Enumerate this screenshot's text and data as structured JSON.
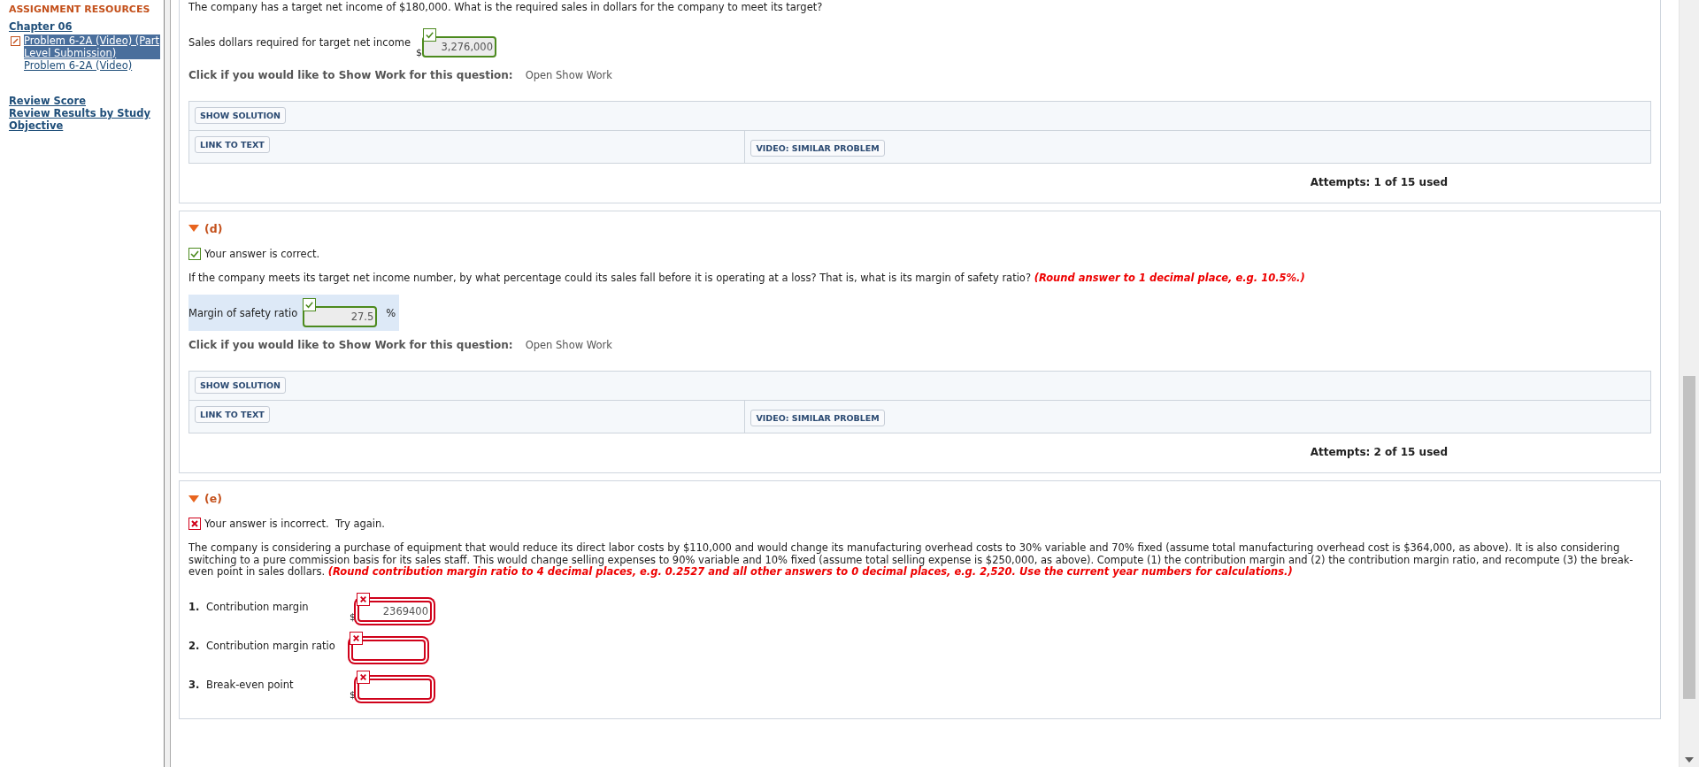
{
  "sidebar": {
    "heading": "ASSIGNMENT RESOURCES",
    "chapter": "Chapter 06",
    "items": [
      {
        "label": "Problem 6-2A (Video) (Part Level Submission)",
        "selected": true
      },
      {
        "label": "Problem 6-2A (Video)",
        "selected": false
      }
    ],
    "links": [
      "Review Score",
      "Review Results by Study Objective"
    ]
  },
  "parts": [
    {
      "question": {
        "text": "The company has a target net income of $180,000. What is the required sales in dollars for the company to meet its target?"
      },
      "answers": [
        {
          "label": "Sales dollars required for target net income",
          "prefix": "$",
          "value": "3,276,000",
          "correct": true,
          "highlighted": false
        }
      ],
      "show_work": {
        "prompt": "Click if you would like to Show Work for this question:",
        "link": "Open Show Work"
      },
      "resources": [
        [
          "SHOW SOLUTION"
        ],
        [
          "LINK TO TEXT",
          "VIDEO: SIMILAR PROBLEM"
        ]
      ],
      "attempts": "Attempts: 1 of 15 used"
    },
    {
      "label": "(d)",
      "expanded": true,
      "feedback": {
        "correct": true,
        "text": "Your answer is correct."
      },
      "question": {
        "text": "If the company meets its target net income number, by what percentage could its sales fall before it is operating at a loss? That is, what is its margin of safety ratio?",
        "instruction": "(Round answer to 1 decimal place, e.g. 10.5%.)"
      },
      "answers": [
        {
          "label": "Margin of safety ratio",
          "value": "27.5",
          "unit": "%",
          "correct": true,
          "highlighted": true
        }
      ],
      "show_work": {
        "prompt": "Click if you would like to Show Work for this question:",
        "link": "Open Show Work"
      },
      "resources": [
        [
          "SHOW SOLUTION"
        ],
        [
          "LINK TO TEXT",
          "VIDEO: SIMILAR PROBLEM"
        ]
      ],
      "attempts": "Attempts: 2 of 15 used"
    },
    {
      "label": "(e)",
      "expanded": true,
      "feedback": {
        "correct": false,
        "text": "Your answer is incorrect.  Try again."
      },
      "question": {
        "text": "The company is considering a purchase of equipment that would reduce its direct labor costs by $110,000 and would change its manufacturing overhead costs to 30% variable and 70% fixed (assume total manufacturing overhead cost is $364,000, as above). It is also considering switching to a pure commission basis for its sales staff. This would change selling expenses to 90% variable and 10% fixed (assume total selling expense is $250,000, as above). Compute (1) the contribution margin and (2) the contribution margin ratio, and recompute (3) the break-even point in sales dollars.",
        "instruction": "(Round contribution margin ratio to 4 decimal places, e.g. 0.2527 and all other answers to 0 decimal places, e.g. 2,520. Use the current year numbers for calculations.)"
      },
      "answers": [
        {
          "number": "1.",
          "label": "Contribution margin",
          "prefix": "$",
          "value": "2369400",
          "correct": false,
          "highlighted": false
        },
        {
          "number": "2.",
          "label": "Contribution margin ratio",
          "correct": false,
          "highlighted": false
        },
        {
          "number": "3.",
          "label": "Break-even point",
          "prefix": "$",
          "correct": false,
          "highlighted": false
        }
      ]
    }
  ]
}
